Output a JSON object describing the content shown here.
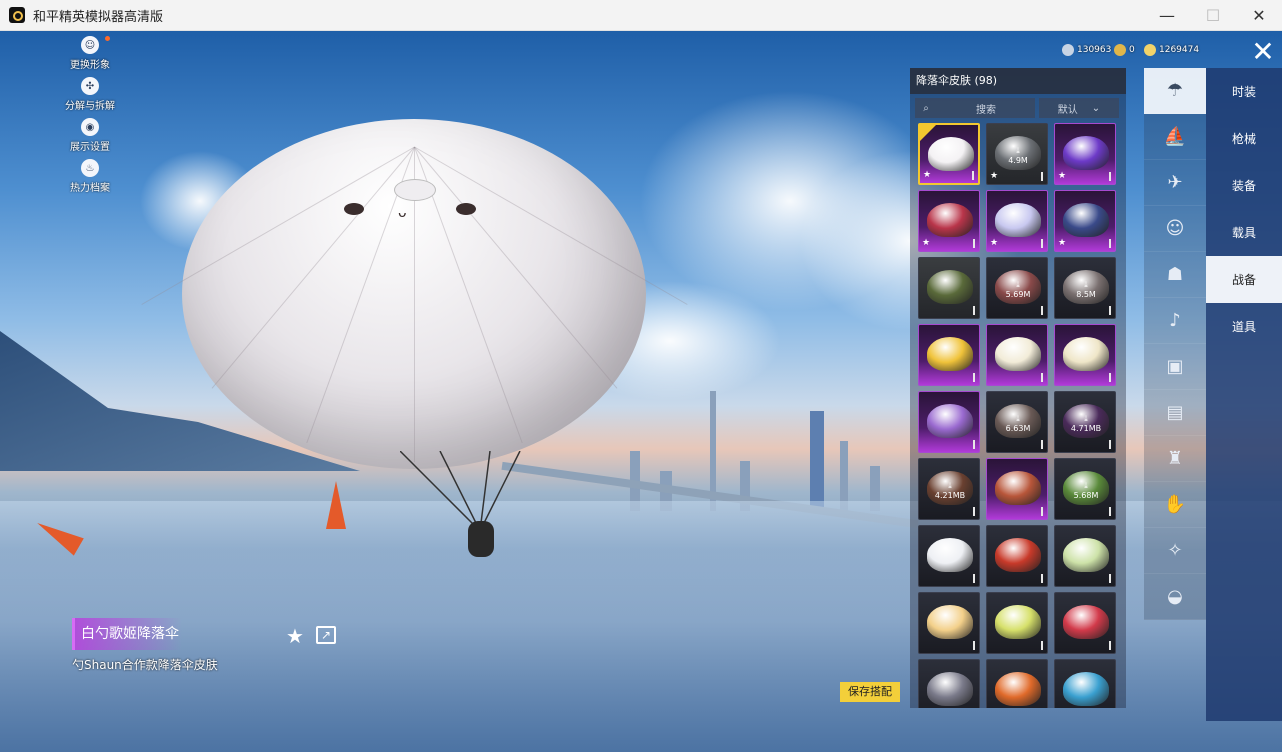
{
  "window": {
    "title": "和平精英模拟器高清版",
    "min_icon": "minimize-icon",
    "max_icon": "maximize-icon",
    "close_icon": "close-icon"
  },
  "left_menu": [
    {
      "label": "更换形象",
      "icon": "avatar-icon",
      "has_dot": true
    },
    {
      "label": "分解与拆解",
      "icon": "puzzle-icon",
      "has_dot": false
    },
    {
      "label": "展示设置",
      "icon": "eye-icon",
      "has_dot": false
    },
    {
      "label": "热力档案",
      "icon": "flame-icon",
      "has_dot": false
    }
  ],
  "currency": [
    {
      "value": "130963",
      "icon": "coin-silver-icon",
      "color": "#c8d4e4"
    },
    {
      "value": "0",
      "icon": "coin-gold-icon",
      "color": "#e0b64a"
    },
    {
      "value": "1269474",
      "icon": "coin-ticket-icon",
      "color": "#f2d36a"
    }
  ],
  "panel": {
    "title": "降落伞皮肤 (98)",
    "search_placeholder": "搜索",
    "sort_label": "默认"
  },
  "grid": [
    {
      "style": "purple",
      "color": "#f4f2f4",
      "selected": true,
      "star": true,
      "dl": ""
    },
    {
      "style": "gray",
      "color": "#6b6f74",
      "selected": false,
      "star": true,
      "dl": "4.9M"
    },
    {
      "style": "purple",
      "color": "#6d3ac8",
      "selected": false,
      "star": true,
      "dl": ""
    },
    {
      "style": "purple",
      "color": "#b9354a",
      "selected": false,
      "star": true,
      "dl": ""
    },
    {
      "style": "purple",
      "color": "#c8c8f0",
      "selected": false,
      "star": true,
      "dl": ""
    },
    {
      "style": "purple",
      "color": "#3a4a8a",
      "selected": false,
      "star": true,
      "dl": ""
    },
    {
      "style": "gray",
      "color": "#5a6a3a",
      "selected": false,
      "star": false,
      "dl": ""
    },
    {
      "style": "dark",
      "color": "#8a4a4a",
      "selected": false,
      "star": false,
      "dl": "5.69M"
    },
    {
      "style": "dark",
      "color": "#7a7070",
      "selected": false,
      "star": false,
      "dl": "8.5M"
    },
    {
      "style": "purple",
      "color": "#f0c33a",
      "selected": false,
      "star": false,
      "dl": ""
    },
    {
      "style": "purple",
      "color": "#f2ecd8",
      "selected": false,
      "star": false,
      "dl": ""
    },
    {
      "style": "purple",
      "color": "#efe6c8",
      "selected": false,
      "star": false,
      "dl": ""
    },
    {
      "style": "purple",
      "color": "#9a6ad0",
      "selected": false,
      "star": false,
      "dl": ""
    },
    {
      "style": "dark",
      "color": "#6a5a56",
      "selected": false,
      "star": false,
      "dl": "6.63M"
    },
    {
      "style": "dark",
      "color": "#4a2a5a",
      "selected": false,
      "star": false,
      "dl": "4.71MB"
    },
    {
      "style": "dark",
      "color": "#6a4030",
      "selected": false,
      "star": false,
      "dl": "4.21MB"
    },
    {
      "style": "purple",
      "color": "#b8563a",
      "selected": false,
      "star": false,
      "dl": ""
    },
    {
      "style": "dark",
      "color": "#5a8a3a",
      "selected": false,
      "star": false,
      "dl": "5.68M"
    },
    {
      "style": "dark",
      "color": "#eef0f4",
      "selected": false,
      "star": false,
      "dl": ""
    },
    {
      "style": "dark",
      "color": "#c83a2a",
      "selected": false,
      "star": false,
      "dl": ""
    },
    {
      "style": "dark",
      "color": "#cde2a8",
      "selected": false,
      "star": false,
      "dl": ""
    },
    {
      "style": "dark",
      "color": "#f3d08a",
      "selected": false,
      "star": false,
      "dl": ""
    },
    {
      "style": "dark",
      "color": "#d6e06a",
      "selected": false,
      "star": false,
      "dl": ""
    },
    {
      "style": "dark",
      "color": "#d23a4a",
      "selected": false,
      "star": false,
      "dl": ""
    },
    {
      "style": "dark",
      "color": "#7a7a8a",
      "selected": false,
      "star": false,
      "dl": ""
    },
    {
      "style": "dark",
      "color": "#e06a2a",
      "selected": false,
      "star": false,
      "dl": ""
    },
    {
      "style": "dark",
      "color": "#3aa0d0",
      "selected": false,
      "star": false,
      "dl": ""
    }
  ],
  "categories": [
    {
      "icon": "parachute-icon",
      "active": true
    },
    {
      "icon": "boat-icon",
      "active": false
    },
    {
      "icon": "plane-icon",
      "active": false
    },
    {
      "icon": "emote-icon",
      "active": false
    },
    {
      "icon": "robot-icon",
      "active": false
    },
    {
      "icon": "sound-icon",
      "active": false
    },
    {
      "icon": "badge-icon",
      "active": false
    },
    {
      "icon": "picture-icon",
      "active": false
    },
    {
      "icon": "extinguisher-icon",
      "active": false
    },
    {
      "icon": "hand-icon",
      "active": false
    },
    {
      "icon": "wand-icon",
      "active": false
    },
    {
      "icon": "ufo-icon",
      "active": false
    }
  ],
  "tabs": [
    {
      "label": "时装",
      "active": false
    },
    {
      "label": "枪械",
      "active": false
    },
    {
      "label": "装备",
      "active": false
    },
    {
      "label": "载具",
      "active": false
    },
    {
      "label": "战备",
      "active": true
    },
    {
      "label": "道具",
      "active": false
    }
  ],
  "item": {
    "name": "白勺歌姬降落伞",
    "desc": "勺Shaun合作款降落伞皮肤"
  },
  "save_button": "保存搭配"
}
